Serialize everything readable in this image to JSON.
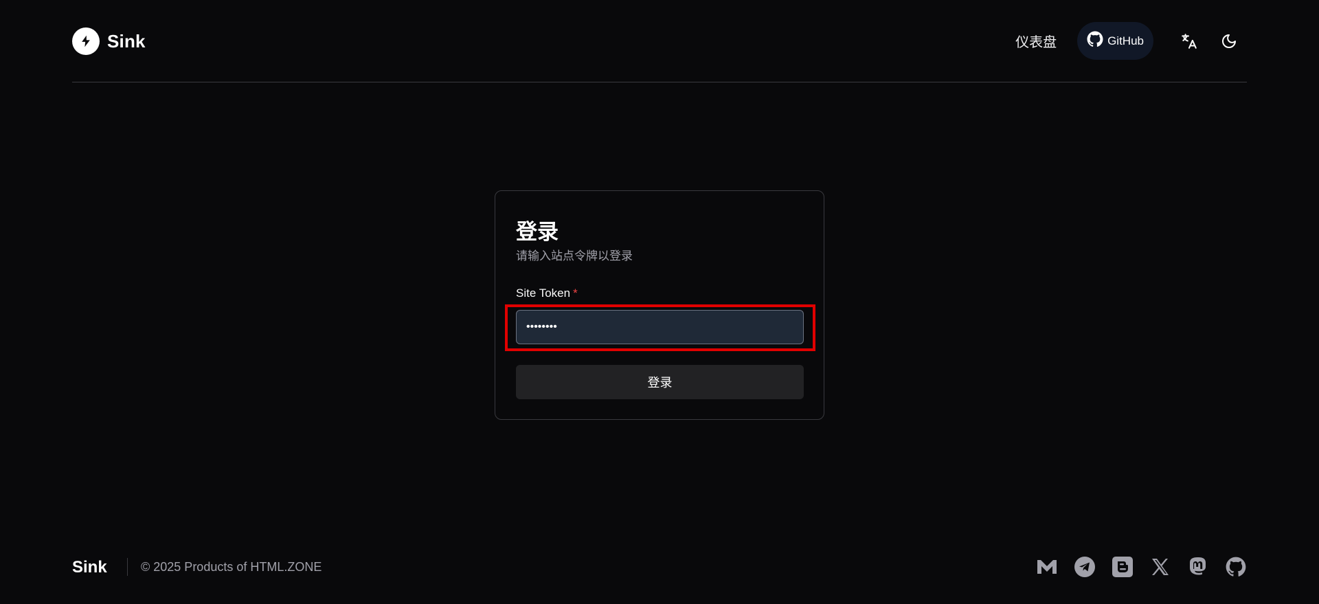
{
  "brand": {
    "name": "Sink"
  },
  "nav": {
    "dashboard_label": "仪表盘",
    "github_label": "GitHub"
  },
  "login": {
    "title": "登录",
    "description": "请输入站点令牌以登录",
    "field_label": "Site Token",
    "required_mark": "*",
    "token_value": "SinkCool",
    "submit_label": "登录"
  },
  "footer": {
    "brand": "Sink",
    "copyright": "© 2025 Products of HTML.ZONE",
    "social_icons": [
      "mail-icon",
      "telegram-icon",
      "blogger-icon",
      "x-icon",
      "mastodon-icon",
      "github-icon"
    ]
  },
  "colors": {
    "background": "#09090b",
    "input_bg": "#1f2937",
    "github_btn_bg": "#111827",
    "highlight": "#e00000",
    "required": "#ef4444"
  }
}
